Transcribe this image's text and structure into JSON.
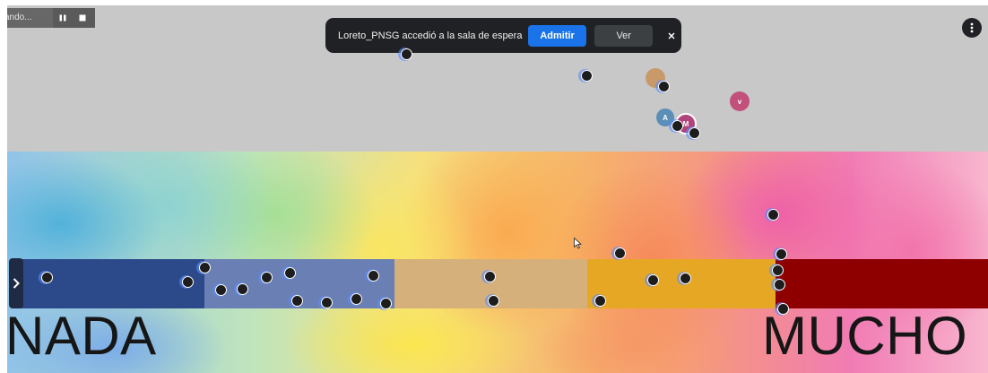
{
  "recording": {
    "label": "ando...",
    "pause_icon": "pause-icon",
    "stop_icon": "stop-icon"
  },
  "notification": {
    "message": "Loreto_PNSG accedió a la sala de espera",
    "admit_label": "Admitir",
    "view_label": "Ver",
    "close_icon": "close-icon"
  },
  "menu": {
    "icon": "more-vert-icon"
  },
  "board": {
    "left_label": "NADA",
    "right_label": "MUCHO",
    "band_colors": [
      "#2c4a8a",
      "#6a80b4",
      "#d6b07a",
      "#e6a824",
      "#8e0000"
    ]
  },
  "avatars": [
    {
      "initial": "",
      "color": "#c89a6a"
    },
    {
      "initial": "v",
      "color": "#c2507a"
    },
    {
      "initial": "A",
      "color": "#5b8fb8"
    },
    {
      "initial": "M",
      "color": "#b0437b"
    }
  ],
  "participant_icon": "mic-off-icon",
  "colors": {
    "accent": "#1a73e8",
    "toast_bg": "#202124"
  }
}
